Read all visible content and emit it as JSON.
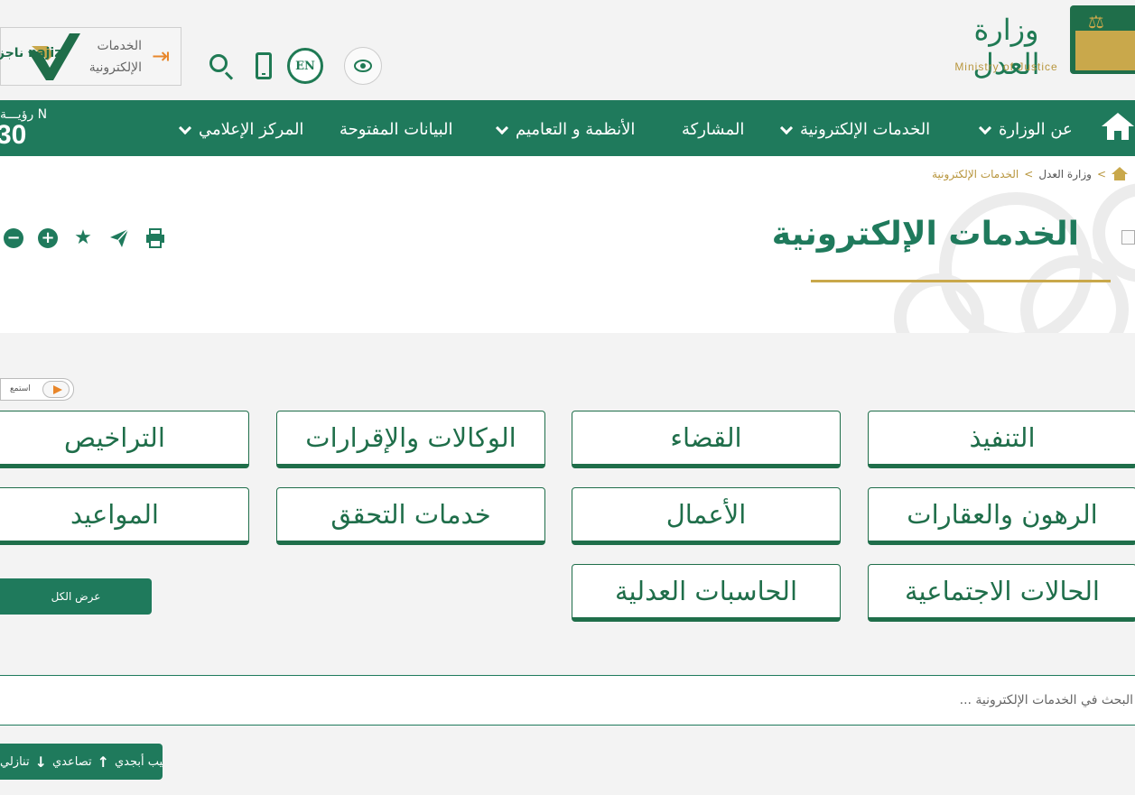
{
  "header": {
    "logo_ar": "وزارة العدل",
    "logo_en": "Ministry of Justice",
    "en_label": "EN",
    "eservices_label": "الخدمات الإلكترونية",
    "najiz_text": "ناجز najiz"
  },
  "nav": {
    "items": [
      {
        "label": "عن الوزارة",
        "has_dropdown": true
      },
      {
        "label": "الخدمات الإلكترونية",
        "has_dropdown": true
      },
      {
        "label": "المشاركة",
        "has_dropdown": false
      },
      {
        "label": "الأنظمة و التعاميم",
        "has_dropdown": true
      },
      {
        "label": "البيانات المفتوحة",
        "has_dropdown": false
      },
      {
        "label": "المركز الإعلامي",
        "has_dropdown": true
      }
    ],
    "vision_top": "رؤيـــة N",
    "vision_big": "30"
  },
  "breadcrumb": {
    "sep": ">",
    "link": "وزارة العدل",
    "current": "الخدمات الإلكترونية"
  },
  "page": {
    "title": "الخدمات الإلكترونية"
  },
  "listen": {
    "label": "استمع"
  },
  "services": [
    "التنفيذ",
    "القضاء",
    "الوكالات والإقرارات",
    "التراخيص",
    "الرهون والعقارات",
    "الأعمال",
    "خدمات التحقق",
    "المواعيد",
    "الحالات الاجتماعية",
    "الحاسبات العدلية"
  ],
  "view_all": "عرض الكل",
  "search": {
    "placeholder": "البحث في الخدمات الإلكترونية ..."
  },
  "sort": {
    "label": "ترتيب أبجدي",
    "asc": "تصاعدي",
    "desc": "تنازلي"
  },
  "colors": {
    "primary": "#1f7a5c",
    "gold": "#c9a84b",
    "accent": "#e8862a"
  }
}
